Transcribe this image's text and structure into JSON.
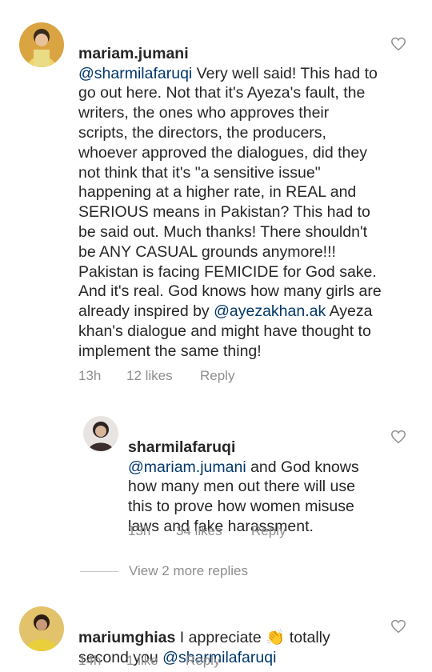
{
  "comments": [
    {
      "username": "mariam.jumani",
      "mention": "@sharmilafaruqi",
      "text_before": " Very well said! This had to go out here. Not that it's Ayeza's fault, the writers, the ones who approves their scripts, the directors, the producers, whoever approved the dialogues, did they not think that it's \"a sensitive issue\" happening at a higher rate, in REAL and SERIOUS means in Pakistan? This had to be said out. Much thanks! There shouldn't be ANY CASUAL grounds anymore!!! Pakistan is facing FEMICIDE for God sake. And it's real. God knows how many girls are already inspired by ",
      "mention2": "@ayezakhan.ak",
      "text_after": " Ayeza khan's dialogue and might have thought to implement the same thing!",
      "time": "13h",
      "likes": "12 likes",
      "reply": "Reply"
    },
    {
      "username": "sharmilafaruqi",
      "mention": "@mariam.jumani",
      "text": " and God knows how many men out there will use this to prove how women misuse laws and fake harassment.",
      "time": "13h",
      "likes": "34 likes",
      "reply": "Reply"
    },
    {
      "username": "mariumghias",
      "text_before": " I appreciate ",
      "emoji": "👏",
      "text_after": " totally second you ",
      "mention": "@sharmilafaruqi",
      "time": "14h",
      "likes": "1 like",
      "reply": "Reply"
    }
  ],
  "view_more": "View 2 more replies",
  "icons": {
    "heart": "heart-outline-icon"
  },
  "colors": {
    "text": "#262626",
    "meta": "#8e8e8e",
    "mention": "#00376b"
  }
}
